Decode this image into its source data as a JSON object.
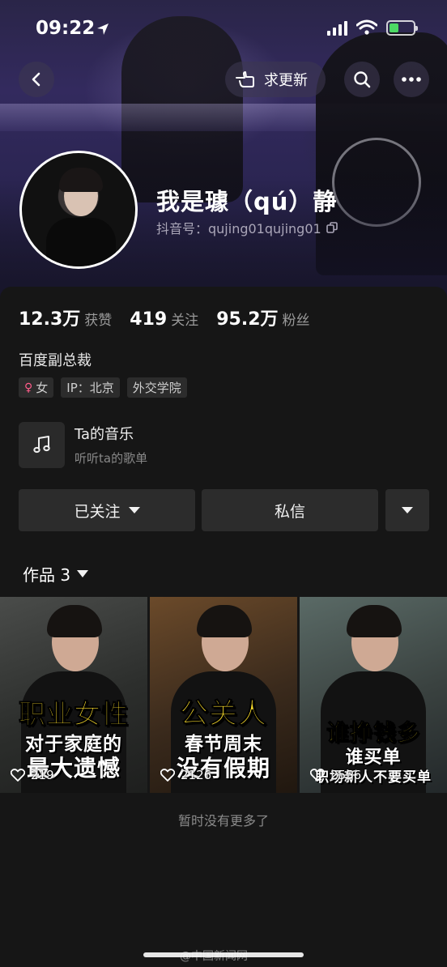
{
  "status_bar": {
    "time": "09:22"
  },
  "header": {
    "request_update_label": "求更新"
  },
  "profile": {
    "name": "我是璩（qú）静",
    "douyin_id_label": "抖音号：qujing01qujing01",
    "stats": [
      {
        "value": "12.3万",
        "label": "获赞"
      },
      {
        "value": "419",
        "label": "关注"
      },
      {
        "value": "95.2万",
        "label": "粉丝"
      }
    ],
    "bio": "百度副总裁",
    "tags": {
      "gender": "女",
      "ip": "IP：北京",
      "school": "外交学院"
    }
  },
  "music": {
    "title": "Ta的音乐",
    "subtitle": "听听ta的歌单"
  },
  "actions": {
    "follow_label": "已关注",
    "message_label": "私信"
  },
  "works": {
    "tab_label": "作品 3",
    "items": [
      {
        "caption1": "职业女性",
        "caption2": "对于家庭的",
        "caption3": "最大遗憾",
        "likes": "219"
      },
      {
        "caption1": "公关人",
        "caption2": "春节周末",
        "caption3": "没有假期",
        "likes": "2126"
      },
      {
        "caption1": "谁挣钱多",
        "caption2": "谁买单",
        "caption3": "职场新人不要买单",
        "likes": "2556"
      }
    ]
  },
  "footer_text": "暂时没有更多了",
  "watermark": "@中国新闻网",
  "colors": {
    "background": "#161616",
    "button": "#2c2c2c",
    "caption_yellow": "#ffe12b"
  }
}
